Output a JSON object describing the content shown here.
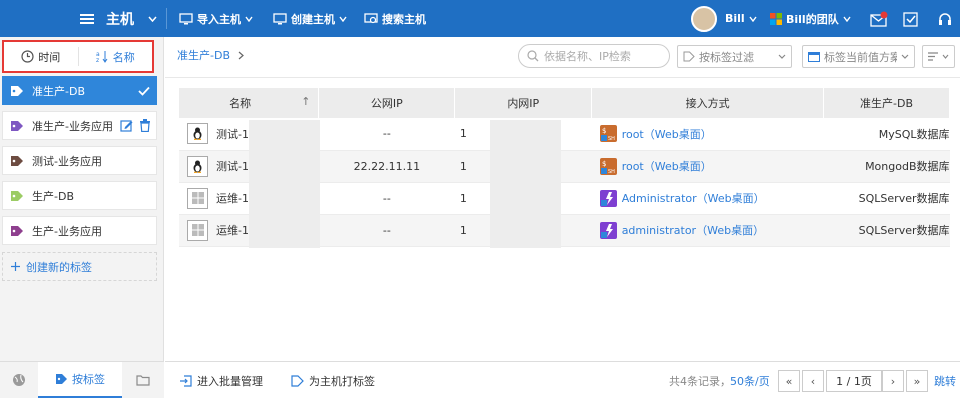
{
  "topbar": {
    "title": "主机",
    "import_label": "导入主机",
    "create_label": "创建主机",
    "search_label": "搜索主机",
    "user": "Bill",
    "team": "Bill的团队"
  },
  "sidebar": {
    "sort_time": "时间",
    "sort_name": "名称",
    "tags": [
      {
        "label": "准生产-DB",
        "color": "#ffffff"
      },
      {
        "label": "准生产-业务应用",
        "color": "#7e57c2"
      },
      {
        "label": "测试-业务应用",
        "color": "#6d4c41"
      },
      {
        "label": "生产-DB",
        "color": "#9ccc65"
      },
      {
        "label": "生产-业务应用",
        "color": "#8e3f8e"
      }
    ],
    "new_tag": "创建新的标签",
    "bottom_tab": "按标签"
  },
  "main": {
    "breadcrumb": "准生产-DB",
    "search_placeholder": "依据名称、IP检索",
    "tag_filter": "按标签过滤",
    "tag_scheme": "标签当前值方案"
  },
  "table": {
    "headers": [
      "名称",
      "公网IP",
      "内网IP",
      "接入方式",
      "准生产-DB"
    ],
    "rows": [
      {
        "name": "测试-1",
        "os": "linux",
        "public_ip": "--",
        "private_ip": "1",
        "access": "root（Web桌面）",
        "access_type": "ssh",
        "db": "MySQL数据库"
      },
      {
        "name": "测试-1",
        "os": "linux",
        "public_ip": "22.22.11.11",
        "private_ip": "1",
        "access": "root（Web桌面）",
        "access_type": "ssh",
        "db": "MongodB数据库"
      },
      {
        "name": "运维-1",
        "os": "windows",
        "public_ip": "--",
        "private_ip": "1",
        "access": "Administrator（Web桌面）",
        "access_type": "rdp",
        "db": "SQLServer数据库"
      },
      {
        "name": "运维-1",
        "os": "windows",
        "public_ip": "--",
        "private_ip": "1",
        "access": "administrator（Web桌面）",
        "access_type": "rdp",
        "db": "SQLServer数据库"
      }
    ]
  },
  "footer": {
    "batch": "进入批量管理",
    "tagging": "为主机打标签",
    "total": "共4条记录，",
    "per_page": "50条/页",
    "page": "1 / 1页",
    "jump": "跳转"
  },
  "colors": {
    "brand": "#1f6fc3",
    "accent": "#2f86da",
    "highlight_border": "#e53935"
  }
}
